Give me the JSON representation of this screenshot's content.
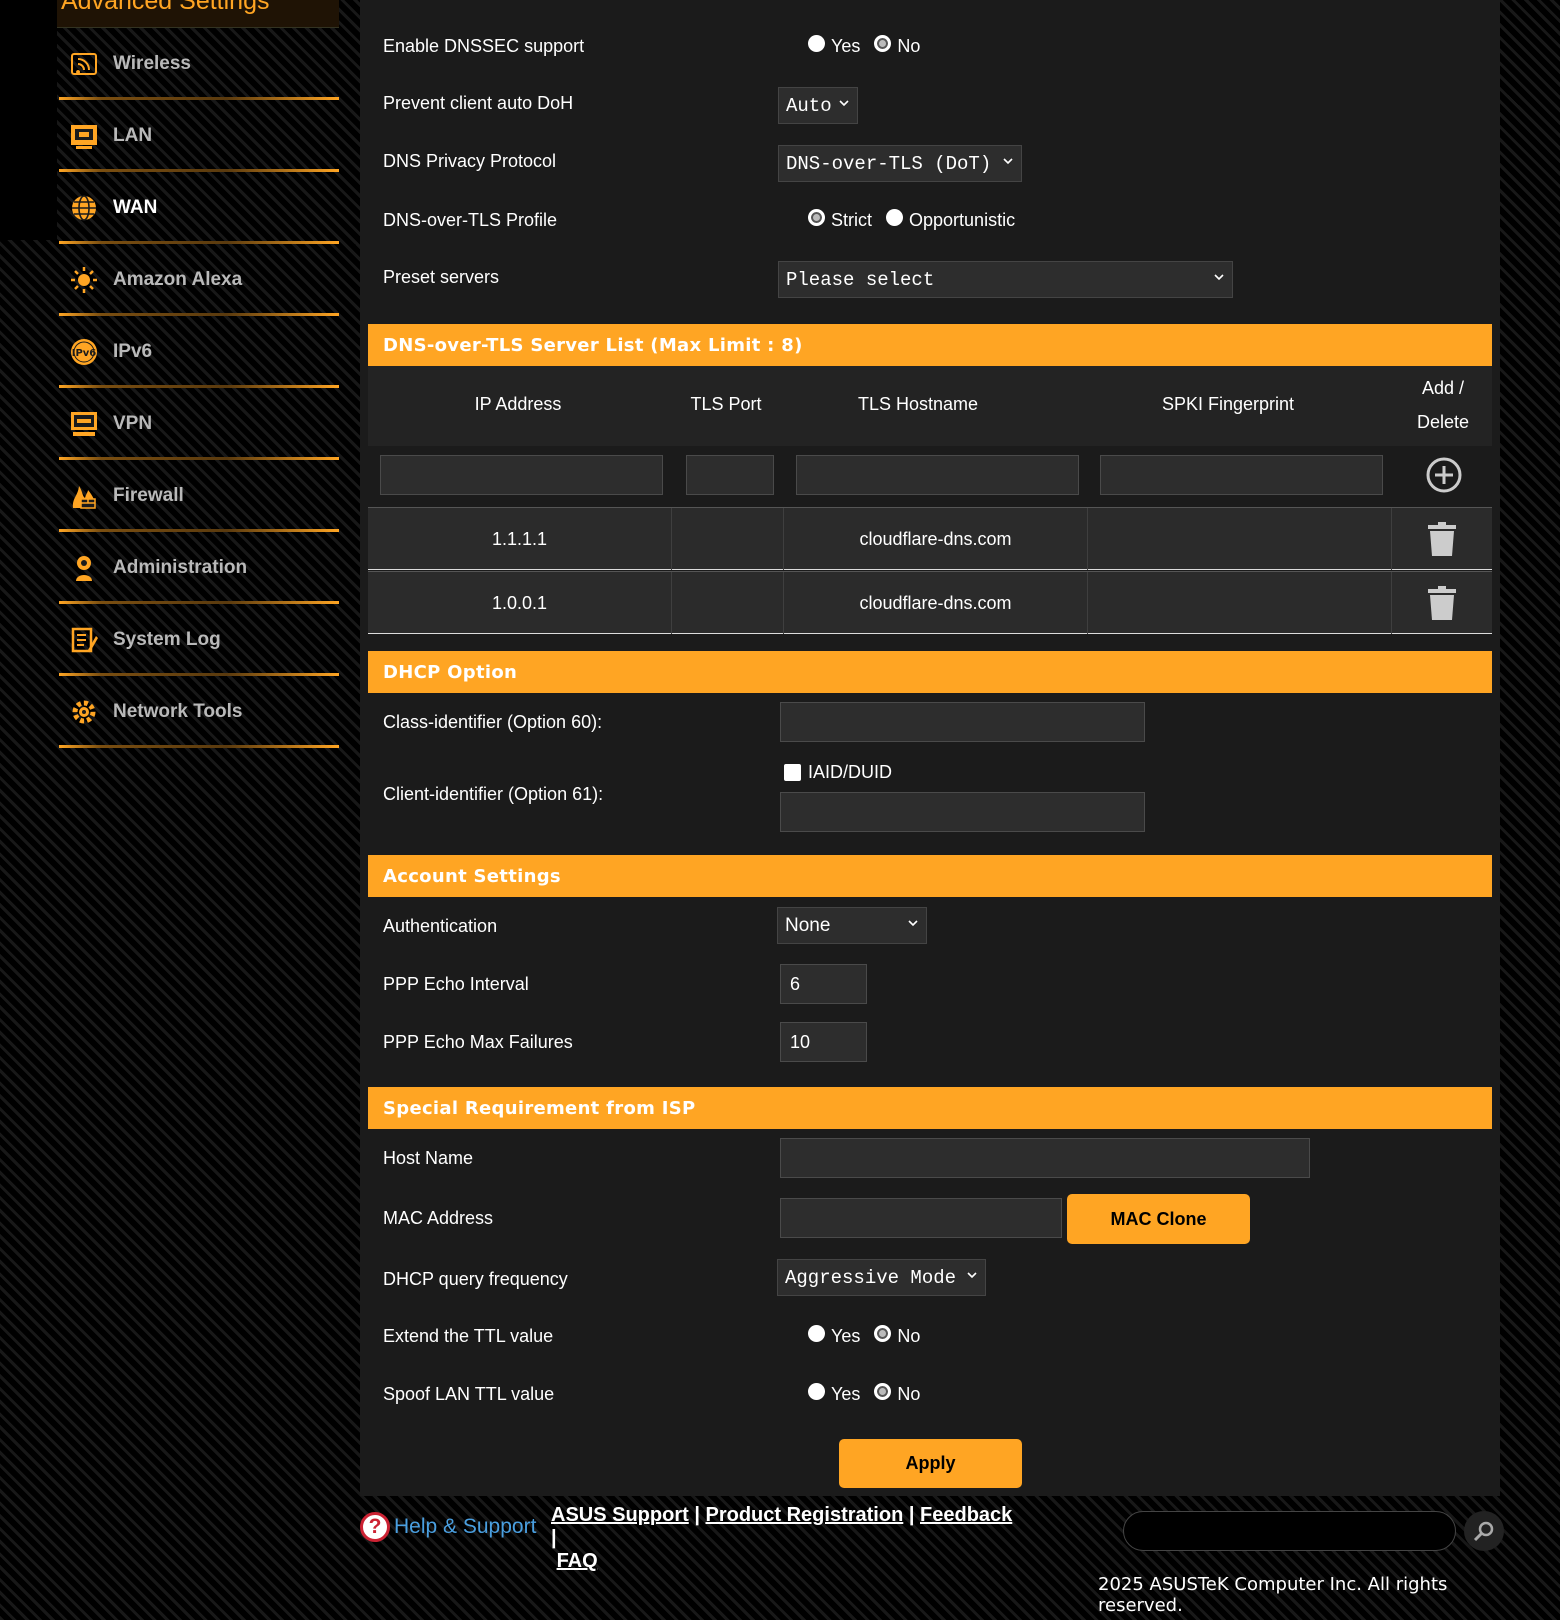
{
  "sidebar": {
    "header": "Advanced Settings",
    "items": [
      {
        "label": "Wireless",
        "icon": "wireless-icon"
      },
      {
        "label": "LAN",
        "icon": "lan-icon"
      },
      {
        "label": "WAN",
        "icon": "globe-icon",
        "active": true
      },
      {
        "label": "Amazon Alexa",
        "icon": "alexa-icon"
      },
      {
        "label": "IPv6",
        "icon": "ipv6-icon"
      },
      {
        "label": "VPN",
        "icon": "vpn-icon"
      },
      {
        "label": "Firewall",
        "icon": "firewall-icon"
      },
      {
        "label": "Administration",
        "icon": "administration-icon"
      },
      {
        "label": "System Log",
        "icon": "system-log-icon"
      },
      {
        "label": "Network Tools",
        "icon": "network-tools-icon"
      }
    ]
  },
  "dns": {
    "dnssec_label": "Enable DNSSEC support",
    "dnssec_yes": "Yes",
    "dnssec_no": "No",
    "dnssec_value": "No",
    "doh_label": "Prevent client auto DoH",
    "doh_value": "Auto",
    "privacy_label": "DNS Privacy Protocol",
    "privacy_value": "DNS-over-TLS (DoT)",
    "profile_label": "DNS-over-TLS Profile",
    "profile_strict": "Strict",
    "profile_opportunistic": "Opportunistic",
    "profile_value": "Strict",
    "preset_label": "Preset servers",
    "preset_value": "Please select"
  },
  "dot_list": {
    "title": "DNS-over-TLS Server List (Max Limit : 8)",
    "headers": {
      "ip": "IP Address",
      "port": "TLS Port",
      "hostname": "TLS Hostname",
      "spki": "SPKI Fingerprint",
      "add_delete_1": "Add /",
      "add_delete_2": "Delete"
    },
    "rows": [
      {
        "ip": "1.1.1.1",
        "port": "",
        "hostname": "cloudflare-dns.com",
        "spki": ""
      },
      {
        "ip": "1.0.0.1",
        "port": "",
        "hostname": "cloudflare-dns.com",
        "spki": ""
      }
    ]
  },
  "dhcp": {
    "title": "DHCP Option",
    "class_label": "Class-identifier (Option 60):",
    "class_value": "",
    "client_label": "Client-identifier (Option 61):",
    "iaid_label": "IAID/DUID",
    "iaid_checked": false,
    "client_value": ""
  },
  "account": {
    "title": "Account Settings",
    "auth_label": "Authentication",
    "auth_value": "None",
    "echo_interval_label": "PPP Echo Interval",
    "echo_interval_value": "6",
    "echo_fail_label": "PPP Echo Max Failures",
    "echo_fail_value": "10"
  },
  "isp": {
    "title": "Special Requirement from ISP",
    "host_label": "Host Name",
    "host_value": "",
    "mac_label": "MAC Address",
    "mac_value": "",
    "mac_clone": "MAC Clone",
    "dhcp_freq_label": "DHCP query frequency",
    "dhcp_freq_value": "Aggressive Mode",
    "ttl_label": "Extend the TTL value",
    "ttl_yes": "Yes",
    "ttl_no": "No",
    "ttl_value": "No",
    "spoof_label": "Spoof LAN TTL value",
    "spoof_yes": "Yes",
    "spoof_no": "No",
    "spoof_value": "No"
  },
  "apply": "Apply",
  "footer": {
    "help": "Help & Support",
    "links": [
      "ASUS Support",
      "Product Registration",
      "Feedback",
      "FAQ"
    ],
    "search_value": "",
    "copyright": "2025 ASUSTeK Computer Inc. All rights reserved."
  },
  "colors": {
    "accent": "#ffa523",
    "panel": "#1b1b1b",
    "help_link": "#4a9fe0"
  }
}
